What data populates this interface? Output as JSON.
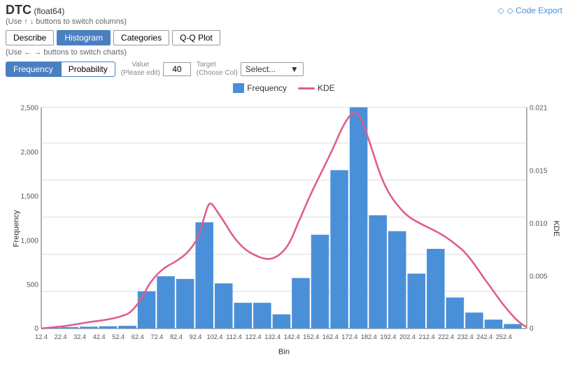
{
  "header": {
    "title": "DTC",
    "type": "(float64)",
    "hint1": "(Use ↑ ↓ buttons to switch columns)",
    "code_export_label": "◇ Code Export",
    "hint2": "(Use ← → buttons to switch charts)"
  },
  "tabs": [
    {
      "label": "Describe",
      "active": false
    },
    {
      "label": "Histogram",
      "active": true
    },
    {
      "label": "Categories",
      "active": false
    },
    {
      "label": "Q-Q Plot",
      "active": false
    }
  ],
  "controls": {
    "frequency_label": "Frequency",
    "probability_label": "Probability",
    "frequency_active": true,
    "value_label": "Value",
    "value_hint": "(Please edit)",
    "value": "40",
    "target_label": "Target",
    "target_hint": "(Choose Col)",
    "select_placeholder": "Select..."
  },
  "legend": {
    "frequency_label": "Frequency",
    "kde_label": "KDE"
  },
  "chart": {
    "y_axis_label": "Frequency",
    "y_axis_right_label": "KDE",
    "x_axis_label": "Bin",
    "y_ticks": [
      "0",
      "500",
      "1,000",
      "1,500",
      "2,000",
      "2,500"
    ],
    "y_right_ticks": [
      "0",
      "0.005",
      "0.010",
      "0.015",
      "0.021"
    ],
    "x_ticks": [
      "12.4",
      "22.4",
      "32.4",
      "42.4",
      "52.4",
      "62.4",
      "72.4",
      "82.4",
      "92.4",
      "102.4",
      "112.4",
      "122.4",
      "132.4",
      "142.4",
      "152.4",
      "162.4",
      "172.4",
      "182.4",
      "192.4",
      "202.4"
    ],
    "bars": [
      {
        "bin": "12.4",
        "value": 10
      },
      {
        "bin": "22.4",
        "value": 15
      },
      {
        "bin": "32.4",
        "value": 20
      },
      {
        "bin": "42.4",
        "value": 25
      },
      {
        "bin": "52.4",
        "value": 30
      },
      {
        "bin": "62.4",
        "value": 420
      },
      {
        "bin": "72.4",
        "value": 590
      },
      {
        "bin": "82.4",
        "value": 560
      },
      {
        "bin": "92.4",
        "value": 1200
      },
      {
        "bin": "102.4",
        "value": 510
      },
      {
        "bin": "112.4",
        "value": 290
      },
      {
        "bin": "122.4",
        "value": 290
      },
      {
        "bin": "132.4",
        "value": 160
      },
      {
        "bin": "142.4",
        "value": 570
      },
      {
        "bin": "152.4",
        "value": 1060
      },
      {
        "bin": "162.4",
        "value": 1790
      },
      {
        "bin": "172.4",
        "value": 2500
      },
      {
        "bin": "182.4",
        "value": 1280
      },
      {
        "bin": "192.4",
        "value": 1100
      },
      {
        "bin": "202.4",
        "value": 620
      },
      {
        "bin": "212.4",
        "value": 900
      },
      {
        "bin": "222.4",
        "value": 350
      },
      {
        "bin": "232.4",
        "value": 180
      },
      {
        "bin": "242.4",
        "value": 100
      },
      {
        "bin": "252.4",
        "value": 50
      }
    ]
  }
}
